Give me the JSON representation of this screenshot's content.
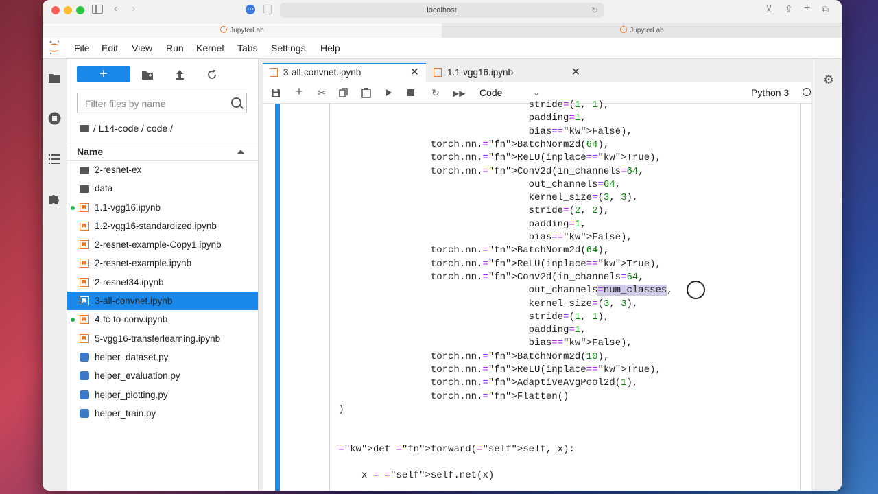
{
  "browser": {
    "url": "localhost",
    "tabs": [
      "JupyterLab",
      "JupyterLab"
    ]
  },
  "menu": [
    "File",
    "Edit",
    "View",
    "Run",
    "Kernel",
    "Tabs",
    "Settings",
    "Help"
  ],
  "filebrowser": {
    "new_label": "+",
    "filter_placeholder": "Filter files by name",
    "breadcrumb": "/ L14-code / code /",
    "column_name": "Name",
    "files": [
      {
        "name": "2-resnet-ex",
        "type": "folder",
        "running": false,
        "selected": false
      },
      {
        "name": "data",
        "type": "folder",
        "running": false,
        "selected": false
      },
      {
        "name": "1.1-vgg16.ipynb",
        "type": "notebook",
        "running": true,
        "selected": false
      },
      {
        "name": "1.2-vgg16-standardized.ipynb",
        "type": "notebook",
        "running": false,
        "selected": false
      },
      {
        "name": "2-resnet-example-Copy1.ipynb",
        "type": "notebook",
        "running": false,
        "selected": false
      },
      {
        "name": "2-resnet-example.ipynb",
        "type": "notebook",
        "running": false,
        "selected": false
      },
      {
        "name": "2-resnet34.ipynb",
        "type": "notebook",
        "running": false,
        "selected": false
      },
      {
        "name": "3-all-convnet.ipynb",
        "type": "notebook",
        "running": false,
        "selected": true
      },
      {
        "name": "4-fc-to-conv.ipynb",
        "type": "notebook",
        "running": true,
        "selected": false
      },
      {
        "name": "5-vgg16-transferlearning.ipynb",
        "type": "notebook",
        "running": false,
        "selected": false
      },
      {
        "name": "helper_dataset.py",
        "type": "python",
        "running": false,
        "selected": false
      },
      {
        "name": "helper_evaluation.py",
        "type": "python",
        "running": false,
        "selected": false
      },
      {
        "name": "helper_plotting.py",
        "type": "python",
        "running": false,
        "selected": false
      },
      {
        "name": "helper_train.py",
        "type": "python",
        "running": false,
        "selected": false
      }
    ]
  },
  "doc_tabs": [
    {
      "name": "3-all-convnet.ipynb",
      "active": true
    },
    {
      "name": "1.1-vgg16.ipynb",
      "active": false
    }
  ],
  "notebook": {
    "cell_type": "Code",
    "kernel": "Python 3",
    "code_lines": [
      "                                  stride=(1, 1),",
      "                                  padding=1,",
      "                                  bias=False),",
      "                 torch.nn.BatchNorm2d(64),",
      "                 torch.nn.ReLU(inplace=True),",
      "                 torch.nn.Conv2d(in_channels=64,",
      "                                  out_channels=64,",
      "                                  kernel_size=(3, 3),",
      "                                  stride=(2, 2),",
      "                                  padding=1,",
      "                                  bias=False),",
      "                 torch.nn.BatchNorm2d(64),",
      "                 torch.nn.ReLU(inplace=True),",
      "                 torch.nn.Conv2d(in_channels=64,",
      "                                  out_channels=num_classes,",
      "                                  kernel_size=(3, 3),",
      "                                  stride=(1, 1),",
      "                                  padding=1,",
      "                                  bias=False),",
      "                 torch.nn.BatchNorm2d(10),",
      "                 torch.nn.ReLU(inplace=True),",
      "                 torch.nn.AdaptiveAvgPool2d(1),",
      "                 torch.nn.Flatten()",
      " )",
      "",
      "",
      " def forward(self, x):",
      "",
      "     x = self.net(x)"
    ]
  }
}
